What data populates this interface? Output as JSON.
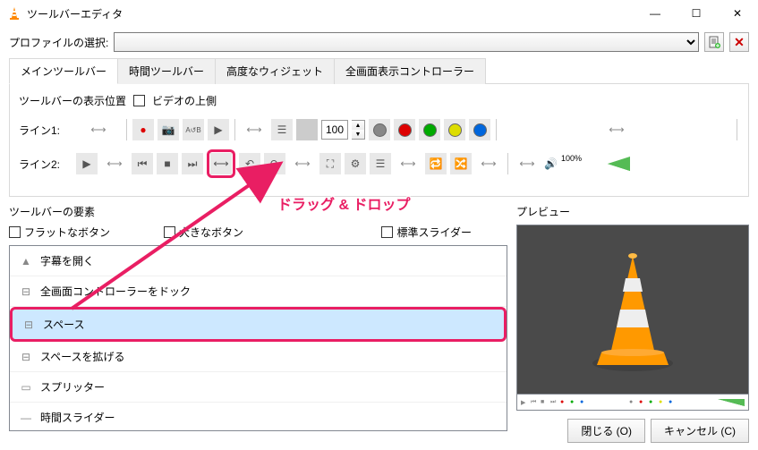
{
  "window": {
    "title": "ツールバーエディタ",
    "min": "—",
    "max": "☐",
    "close": "✕"
  },
  "profile": {
    "label": "プロファイルの選択:",
    "new_icon": "📄",
    "del": "✕"
  },
  "tabs": [
    "メインツールバー",
    "時間ツールバー",
    "高度なウィジェット",
    "全画面表示コントローラー"
  ],
  "toolbar_pos": {
    "label": "ツールバーの表示位置",
    "checkbox": "ビデオの上側"
  },
  "lines": {
    "l1": "ライン1:",
    "l2": "ライン2:"
  },
  "line1": {
    "spacer": "⟷",
    "rec": "●",
    "cam": "📷",
    "ab": "A↺B",
    "play": "▶",
    "spacer2": "⟷",
    "list": "☰",
    "box": "",
    "num": "100",
    "colors": [
      "#888",
      "#d00",
      "#0a0",
      "#dd0",
      "#06d"
    ],
    "spacer3": "⟷"
  },
  "line2": {
    "play": "▶",
    "spacer": "⟷",
    "prev": "⏮",
    "stop": "■",
    "next": "⏭",
    "spacer_btn": "⟷",
    "loopb": "↶",
    "loopf": "↷",
    "spacer2": "⟷",
    "full": "⛶",
    "eq": "⚙",
    "plist": "☰",
    "spacer3": "⟷",
    "loop": "🔁",
    "shuf": "🔀",
    "spacer4": "⟷",
    "vol": "🔊",
    "vol_pct": "100%"
  },
  "elements": {
    "title": "ツールバーの要素",
    "flat": "フラットなボタン",
    "big": "大きなボタン",
    "native": "標準スライダー",
    "items": [
      {
        "icon": "▲",
        "label": "字幕を開く"
      },
      {
        "icon": "⊟",
        "label": "全画面コントローラーをドック"
      },
      {
        "icon": "⊟",
        "label": "スペース"
      },
      {
        "icon": "⊟",
        "label": "スペースを拡げる"
      },
      {
        "icon": "▭",
        "label": "スプリッター"
      },
      {
        "icon": "—",
        "label": "時間スライダー"
      }
    ]
  },
  "preview": {
    "title": "プレビュー"
  },
  "annotation": "ドラッグ & ドロップ",
  "footer": {
    "close": "閉じる (O)",
    "cancel": "キャンセル (C)"
  }
}
